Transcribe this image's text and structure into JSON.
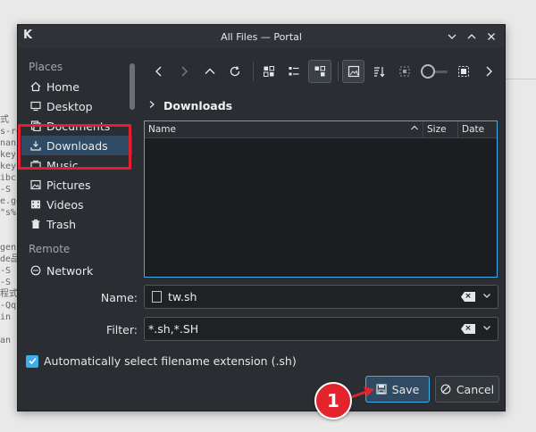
{
  "window": {
    "title": "All Files — Portal",
    "controls": [
      "chevron-down",
      "chevron-up",
      "close"
    ]
  },
  "background_fragments": [
    "式",
    "s-re",
    "nan",
    "key",
    "key",
    "ibc",
    "-S",
    "e.go",
    "\"s%",
    "gen",
    "de品",
    "-S",
    "-S",
    "程式",
    "-Qq",
    "in",
    "an -"
  ],
  "sidebar": {
    "sections": [
      {
        "label": "Places",
        "items": [
          {
            "label": "Home",
            "icon": "home-icon",
            "selected": false
          },
          {
            "label": "Desktop",
            "icon": "desktop-icon",
            "selected": false
          },
          {
            "label": "Documents",
            "icon": "documents-icon",
            "selected": false
          },
          {
            "label": "Downloads",
            "icon": "downloads-icon",
            "selected": true
          },
          {
            "label": "Music",
            "icon": "music-icon",
            "selected": false
          },
          {
            "label": "Pictures",
            "icon": "pictures-icon",
            "selected": false
          },
          {
            "label": "Videos",
            "icon": "videos-icon",
            "selected": false
          },
          {
            "label": "Trash",
            "icon": "trash-icon",
            "selected": false
          }
        ]
      },
      {
        "label": "Remote",
        "items": [
          {
            "label": "Network",
            "icon": "network-icon",
            "selected": false
          }
        ]
      }
    ]
  },
  "toolbar": {
    "buttons": [
      "back-icon",
      "forward-icon",
      "parent-folder-icon",
      "reload-icon",
      "icon-view-icon",
      "compact-view-icon",
      "detailed-view-icon",
      "preview-icon",
      "sort-icon",
      "zoom-icon",
      "zoom-slider",
      "more-icon"
    ]
  },
  "breadcrumb": {
    "current": "Downloads"
  },
  "filelist": {
    "columns": [
      {
        "label": "Name"
      },
      {
        "label": "Size"
      },
      {
        "label": "Date"
      }
    ],
    "rows": []
  },
  "form": {
    "name_label": "Name:",
    "name_value": "tw.sh",
    "filter_label": "Filter:",
    "filter_value": "*.sh,*.SH",
    "auto_ext_label": "Automatically select filename extension (.sh)",
    "auto_ext_checked": true
  },
  "buttons": {
    "save_label": "Save",
    "cancel_label": "Cancel"
  },
  "annotation": {
    "step_number": "1",
    "highlight_color": "#e0202e"
  },
  "colors": {
    "accent": "#3daee9",
    "selection": "#2f4b63",
    "window_bg": "#2a2e32",
    "list_bg": "#1b1e20"
  }
}
